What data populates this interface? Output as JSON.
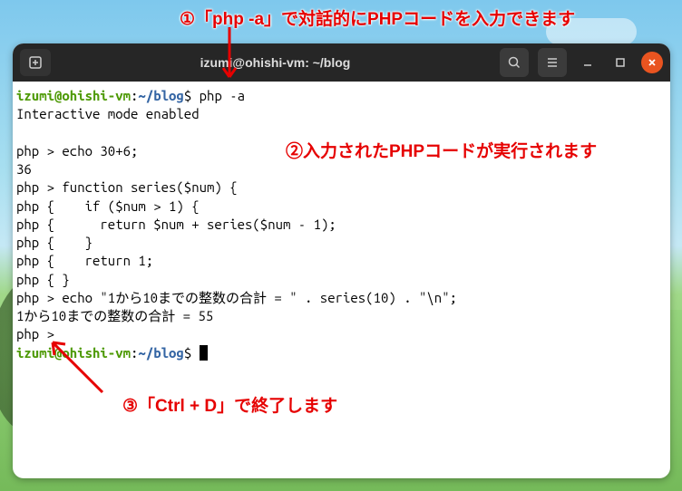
{
  "annotations": {
    "a1": "①「php -a」で対話的にPHPコードを入力できます",
    "a2": "②入力されたPHPコードが実行されます",
    "a3": "③「Ctrl + D」で終了します"
  },
  "titlebar": {
    "title": "izumi@ohishi-vm: ~/blog"
  },
  "prompt": {
    "userhost": "izumi@ohishi-vm",
    "sep": ":",
    "path": "~/blog",
    "sigil": "$"
  },
  "session": {
    "cmd1": "php -a",
    "line_interactive": "Interactive mode enabled",
    "blank": "",
    "l1": "php > echo 30+6;",
    "l2": "36",
    "l3": "php > function series($num) {",
    "l4": "php {    if ($num > 1) {",
    "l5": "php {      return $num + series($num - 1);",
    "l6": "php {    }",
    "l7": "php {    return 1;",
    "l8": "php { }",
    "l9": "php > echo \"1から10までの整数の合計 = \" . series(10) . \"\\n\";",
    "l10": "1から10までの整数の合計 = 55",
    "l11": "php > "
  }
}
